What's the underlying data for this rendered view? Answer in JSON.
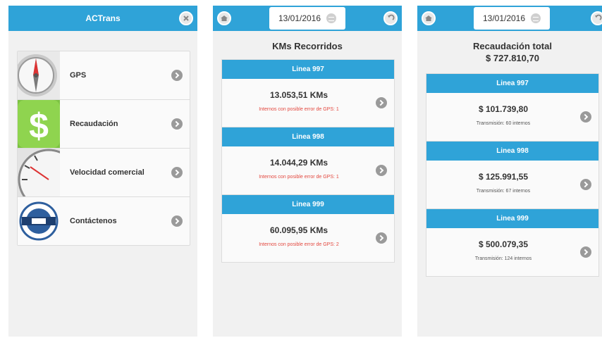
{
  "screen1": {
    "title": "ACTrans",
    "menu": [
      {
        "label": "GPS",
        "icon": "compass-icon"
      },
      {
        "label": "Recaudación",
        "icon": "dollar-icon"
      },
      {
        "label": "Velocidad comercial",
        "icon": "speedometer-icon"
      },
      {
        "label": "Contáctenos",
        "icon": "logo-icon"
      }
    ]
  },
  "screen2": {
    "date": "13/01/2016",
    "title": "KMs Recorridos",
    "lines": [
      {
        "name": "Linea 997",
        "value": "13.053,51 KMs",
        "note": "Internos con posible error de GPS: 1"
      },
      {
        "name": "Linea 998",
        "value": "14.044,29 KMs",
        "note": "Internos con posible error de GPS: 1"
      },
      {
        "name": "Linea 999",
        "value": "60.095,95 KMs",
        "note": "Internos con posible error de GPS: 2"
      }
    ]
  },
  "screen3": {
    "date": "13/01/2016",
    "title": "Recaudación total",
    "total": "$ 727.810,70",
    "lines": [
      {
        "name": "Linea 997",
        "value": "$ 101.739,80",
        "note": "Transmisión: 60 internos"
      },
      {
        "name": "Linea 998",
        "value": "$ 125.991,55",
        "note": "Transmisión: 67 internos"
      },
      {
        "name": "Linea 999",
        "value": "$ 500.079,35",
        "note": "Transmisión: 124 internos"
      }
    ]
  },
  "colors": {
    "accent": "#2fa3d8",
    "error": "#e3483f",
    "background": "#f1f1f1"
  }
}
